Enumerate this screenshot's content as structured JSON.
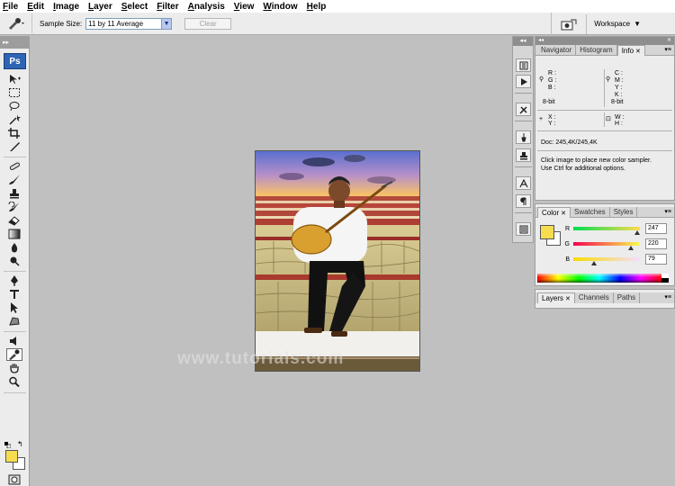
{
  "menu": [
    "File",
    "Edit",
    "Image",
    "Layer",
    "Select",
    "Filter",
    "Analysis",
    "View",
    "Window",
    "Help"
  ],
  "options": {
    "sample_size_label": "Sample Size:",
    "sample_size_value": "11 by 11 Average",
    "clear_label": "Clear",
    "workspace_label": "Workspace"
  },
  "toolbox": {
    "logo": "Ps"
  },
  "foreground_color": "#f7dc4f",
  "background_color": "#ffffff",
  "navigator_panel": {
    "tabs": [
      "Navigator",
      "Histogram",
      "Info"
    ],
    "active_tab": "Info",
    "rgb_labels": [
      "R :",
      "G :",
      "B :"
    ],
    "cmyk_labels": [
      "C :",
      "M :",
      "Y :",
      "K :"
    ],
    "bit_left": "8-bit",
    "bit_right": "8-bit",
    "xy_labels": [
      "X :",
      "Y :"
    ],
    "wh_labels": [
      "W :",
      "H :"
    ],
    "doc_info": "Doc: 245,4K/245,4K",
    "hint_line1": "Click image to place new color sampler.",
    "hint_line2": "Use Ctrl for additional options."
  },
  "color_panel": {
    "tabs": [
      "Color",
      "Swatches",
      "Styles"
    ],
    "active_tab": "Color",
    "r_label": "R",
    "g_label": "G",
    "b_label": "B",
    "r_value": "247",
    "g_value": "220",
    "b_value": "79"
  },
  "layers_panel": {
    "tabs": [
      "Layers",
      "Channels",
      "Paths"
    ],
    "active_tab": "Layers"
  },
  "watermark": "www.tutorials.com"
}
